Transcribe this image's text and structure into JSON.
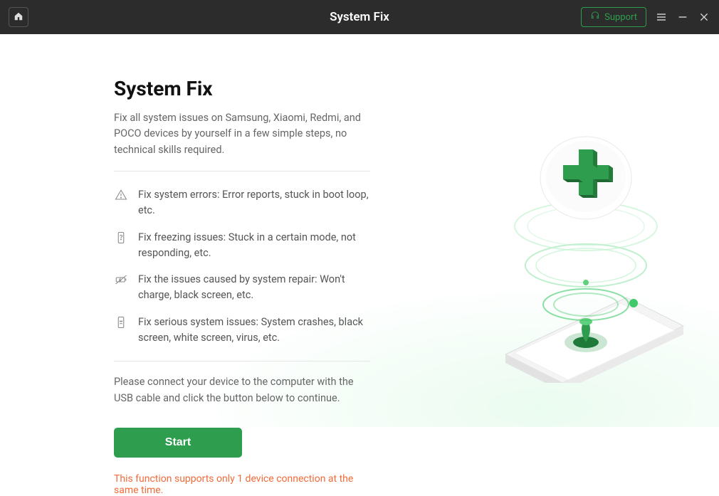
{
  "titlebar": {
    "app_title": "System Fix",
    "support_label": "Support"
  },
  "main": {
    "heading": "System Fix",
    "description": "Fix all system issues on Samsung, Xiaomi, Redmi, and POCO devices by yourself in a few simple steps, no technical skills required.",
    "features": [
      "Fix system errors: Error reports, stuck in boot loop, etc.",
      "Fix freezing issues: Stuck in a certain mode, not responding, etc.",
      "Fix the issues caused by system repair: Won't charge, black screen, etc.",
      "Fix serious system issues: System crashes, black screen, white screen, virus, etc."
    ],
    "instruction": "Please connect your device to the computer with the USB cable and click the button below to continue.",
    "start_label": "Start",
    "note": "This function supports only 1 device connection at the same time."
  }
}
